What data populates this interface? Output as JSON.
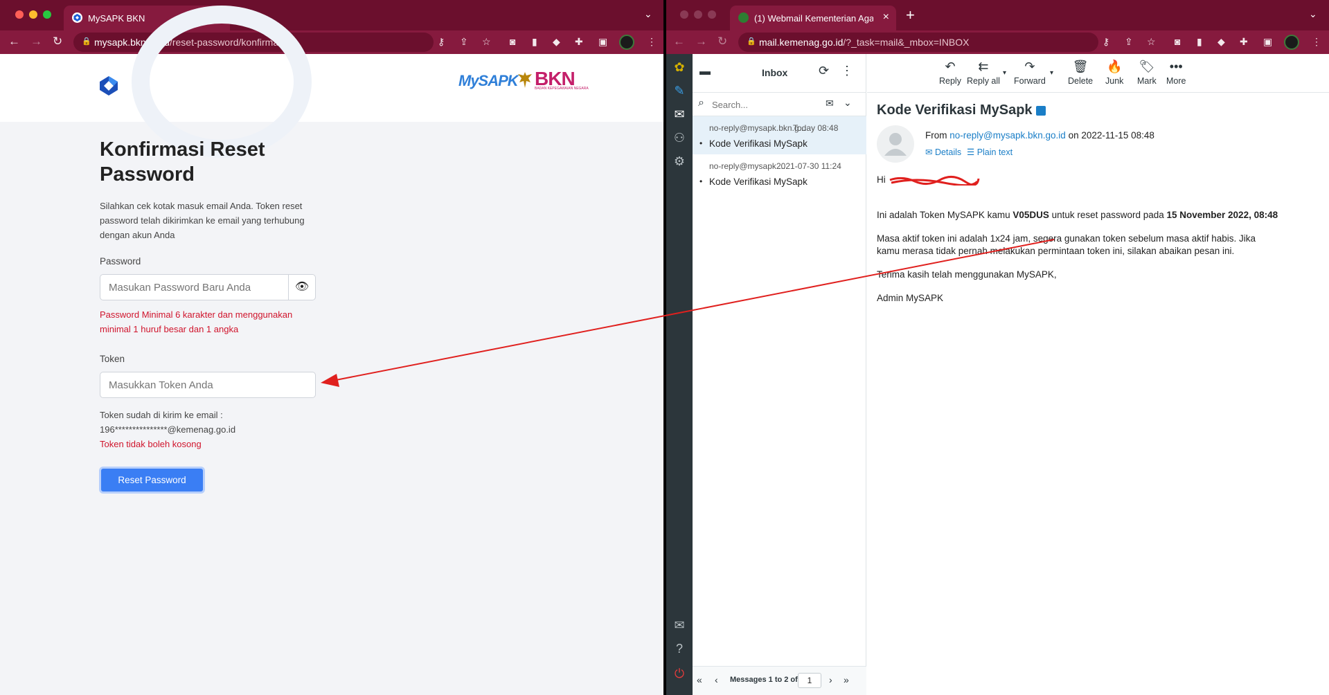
{
  "left_window": {
    "tab": {
      "title": "MySAPK BKN"
    },
    "url": {
      "host": "mysapk.bkn.go.id",
      "path": "/reset-password/konfirmasi"
    },
    "header": {
      "brand": "MySAPK",
      "brand_bkn": "BKN",
      "brand_bkn_sub": "BADAN KEPEGAWAIAN NEGARA"
    },
    "form": {
      "title": "Konfirmasi Reset Password",
      "description": "Silahkan cek kotak masuk email Anda. Token reset password telah dikirimkan ke email yang terhubung dengan akun Anda",
      "password_label": "Password",
      "password_placeholder": "Masukan Password Baru Anda",
      "password_error_1": "Password Minimal 6 karakter dan menggunakan",
      "password_error_2": "minimal 1 huruf besar dan 1 angka",
      "token_label": "Token",
      "token_placeholder": "Masukkan Token Anda",
      "token_sent_label": "Token sudah di kirim ke email :",
      "token_sent_email": "196***************@kemenag.go.id",
      "token_error": "Token tidak boleh kosong",
      "submit_label": "Reset Password"
    },
    "icons": [
      "close-icon",
      "plus-icon",
      "chevron-down-icon",
      "back-icon",
      "forward-icon",
      "reload-icon",
      "lock-icon",
      "key-icon",
      "share-icon",
      "star-icon",
      "camera-icon",
      "extension-icon",
      "puzzle-icon",
      "sidebar-icon",
      "menu-icon",
      "eye-icon"
    ]
  },
  "right_window": {
    "tab": {
      "title": "(1) Webmail Kementerian Agama"
    },
    "url": {
      "host": "mail.kemenag.go.id",
      "path": "/?_task=mail&_mbox=INBOX"
    },
    "list": {
      "folder_title": "Inbox",
      "search_placeholder": "Search...",
      "messages": [
        {
          "from": "no-reply@mysapk.bkn.g...",
          "date": "Today 08:48",
          "subject": "Kode Verifikasi MySapk"
        },
        {
          "from": "no-reply@mysapk....",
          "date": "2021-07-30 11:24",
          "subject": "Kode Verifikasi MySapk"
        }
      ],
      "footer_text": "Messages 1 to 2 of 2",
      "page_number": "1"
    },
    "toolbar": {
      "reply": "Reply",
      "reply_all": "Reply all",
      "forward": "Forward",
      "delete": "Delete",
      "junk": "Junk",
      "mark": "Mark",
      "more": "More"
    },
    "message": {
      "subject": "Kode Verifikasi MySapk",
      "from_prefix": "From",
      "from_address": "no-reply@mysapk.bkn.go.id",
      "date_text": "on 2022-11-15 08:48",
      "details_label": "Details",
      "plain_text_label": "Plain text",
      "greeting": "Hi",
      "line1_prefix": "Ini adalah Token MySAPK kamu ",
      "token": "V05DUS",
      "line1_mid": " untuk reset password pada ",
      "line1_date": "15 November 2022, 08:48",
      "line2": "Masa aktif token ini adalah 1x24 jam, segera gunakan token sebelum masa aktif habis. Jika",
      "line3": "kamu merasa tidak pernah melakukan permintaan token ini, silakan abaikan pesan ini.",
      "line4": "Terima kasih telah menggunakan MySAPK,",
      "line5": "Admin MySAPK"
    },
    "accent_color": "#1a7ec7"
  },
  "chrome_colors": {
    "tab_bar": "#6b0f2d",
    "toolbar": "#861a3e",
    "annotation_arrow": "#e0201e",
    "button": "#3a7ef4",
    "error": "#d0142c"
  }
}
